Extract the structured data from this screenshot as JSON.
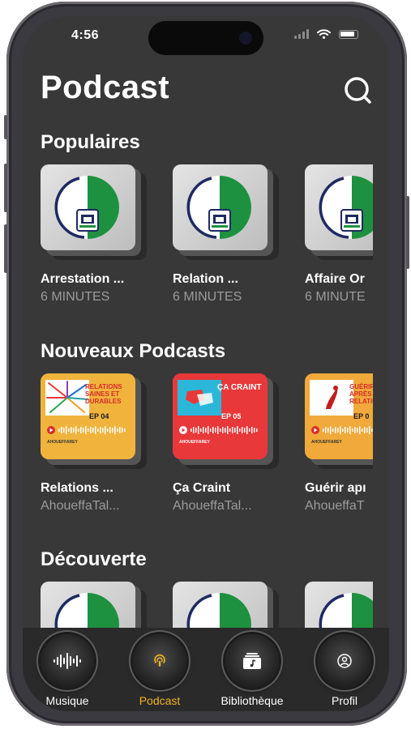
{
  "status": {
    "time": "4:56"
  },
  "header": {
    "title": "Podcast"
  },
  "sections": {
    "popular": {
      "title": "Populaires",
      "items": [
        {
          "title": "Arrestation ...",
          "subtitle": "6 MINUTES"
        },
        {
          "title": "Relation ...",
          "subtitle": "6 MINUTES"
        },
        {
          "title": "Affaire Or",
          "subtitle": "6 MINUTE"
        }
      ]
    },
    "new": {
      "title": "Nouveaux Podcasts",
      "items": [
        {
          "title": "Relations ...",
          "subtitle": "AhoueffaTal...",
          "cover_heading": "RELATIONS SAINES ET DURABLES",
          "episode": "EP 04",
          "brand": "AHOUEFFAREY",
          "color": "#f0b43c"
        },
        {
          "title": "Ça Craint",
          "subtitle": "AhoueffaTal...",
          "cover_heading": "ÇA CRAINT",
          "episode": "EP 05",
          "brand": "AHOUEFFAREY",
          "color": "#e8383a"
        },
        {
          "title": "Guérir apı",
          "subtitle": "AhoueffaT",
          "cover_heading": "GUÉRIR APRÈS UNE RELATION",
          "episode": "EP 0",
          "brand": "AHOUEFFAREY",
          "color": "#f0a93a"
        }
      ]
    },
    "discover": {
      "title": "Découverte"
    }
  },
  "tabs": [
    {
      "label": "Musique",
      "icon": "waveform-icon",
      "active": false
    },
    {
      "label": "Podcast",
      "icon": "podcast-icon",
      "active": true
    },
    {
      "label": "Bibliothèque",
      "icon": "library-icon",
      "active": false
    },
    {
      "label": "Profil",
      "icon": "profile-icon",
      "active": false
    }
  ],
  "colors": {
    "accent": "#f1b324",
    "background": "#383838",
    "logo_green": "#1e9140",
    "logo_navy": "#1f2a63"
  }
}
